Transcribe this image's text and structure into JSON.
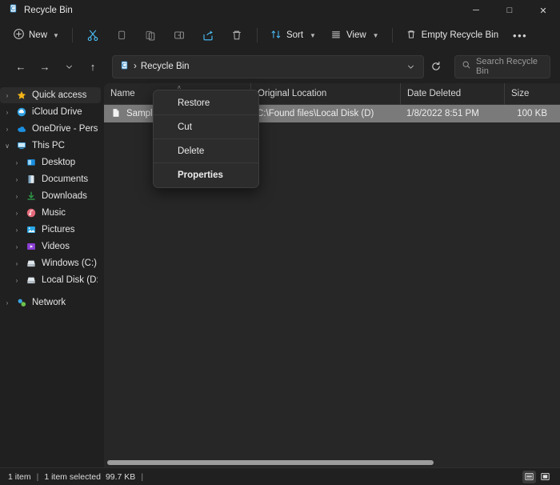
{
  "window": {
    "title": "Recycle Bin",
    "icon": "recycle-bin-icon",
    "controls": {
      "minimize": "─",
      "maximize": "□",
      "close": "✕"
    }
  },
  "toolbar": {
    "new_label": "New",
    "sort_label": "Sort",
    "view_label": "View",
    "empty_label": "Empty Recycle Bin",
    "overflow_label": "•••",
    "icons": [
      "cut-icon",
      "copy-icon",
      "paste-icon",
      "rename-icon",
      "share-icon",
      "delete-icon"
    ]
  },
  "addressbar": {
    "back": "←",
    "forward": "→",
    "recent": "∨",
    "up": "↑",
    "crumb_icon": "recycle-bin-icon",
    "crumb_sep": "›",
    "crumb_label": "Recycle Bin",
    "dropdown": "∨",
    "refresh": "⟳"
  },
  "search": {
    "placeholder": "Search Recycle Bin",
    "icon": "search-icon"
  },
  "sidebar": {
    "items": [
      {
        "label": "Quick access",
        "icon": "star-icon",
        "level": 1,
        "expander": "›",
        "selected": true
      },
      {
        "label": "iCloud Drive",
        "icon": "icloud-icon",
        "level": 1,
        "expander": "›",
        "selected": false
      },
      {
        "label": "OneDrive - Personal",
        "icon": "onedrive-icon",
        "level": 1,
        "expander": "›",
        "selected": false
      },
      {
        "label": "This PC",
        "icon": "pc-icon",
        "level": 1,
        "expander": "∨",
        "selected": false
      },
      {
        "label": "Desktop",
        "icon": "desktop-icon",
        "level": 2,
        "expander": "›",
        "selected": false
      },
      {
        "label": "Documents",
        "icon": "documents-icon",
        "level": 2,
        "expander": "›",
        "selected": false
      },
      {
        "label": "Downloads",
        "icon": "downloads-icon",
        "level": 2,
        "expander": "›",
        "selected": false
      },
      {
        "label": "Music",
        "icon": "music-icon",
        "level": 2,
        "expander": "›",
        "selected": false
      },
      {
        "label": "Pictures",
        "icon": "pictures-icon",
        "level": 2,
        "expander": "›",
        "selected": false
      },
      {
        "label": "Videos",
        "icon": "videos-icon",
        "level": 2,
        "expander": "›",
        "selected": false
      },
      {
        "label": "Windows (C:)",
        "icon": "drive-icon",
        "level": 2,
        "expander": "›",
        "selected": false
      },
      {
        "label": "Local Disk (D:)",
        "icon": "drive-icon",
        "level": 2,
        "expander": "›",
        "selected": false
      },
      {
        "label": "Network",
        "icon": "network-icon",
        "level": 1,
        "expander": "›",
        "selected": false
      }
    ]
  },
  "filelist": {
    "columns": [
      "Name",
      "Original Location",
      "Date Deleted",
      "Size"
    ],
    "sort_indicator": "˄",
    "rows": [
      {
        "name": "Sample",
        "icon": "file-icon",
        "location": "C:\\Found files\\Local Disk (D)",
        "date": "1/8/2022 8:51 PM",
        "size": "100 KB",
        "selected": true
      }
    ]
  },
  "contextmenu": {
    "items": [
      {
        "label": "Restore",
        "bold": false
      },
      {
        "label": "Cut",
        "bold": false
      },
      {
        "label": "Delete",
        "bold": false
      },
      {
        "label": "Properties",
        "bold": true
      }
    ]
  },
  "statusbar": {
    "count": "1 item",
    "selection": "1 item selected",
    "selection_size": "99.7 KB",
    "separator": "|",
    "views": [
      "details-view-icon",
      "large-icons-view-icon"
    ]
  }
}
